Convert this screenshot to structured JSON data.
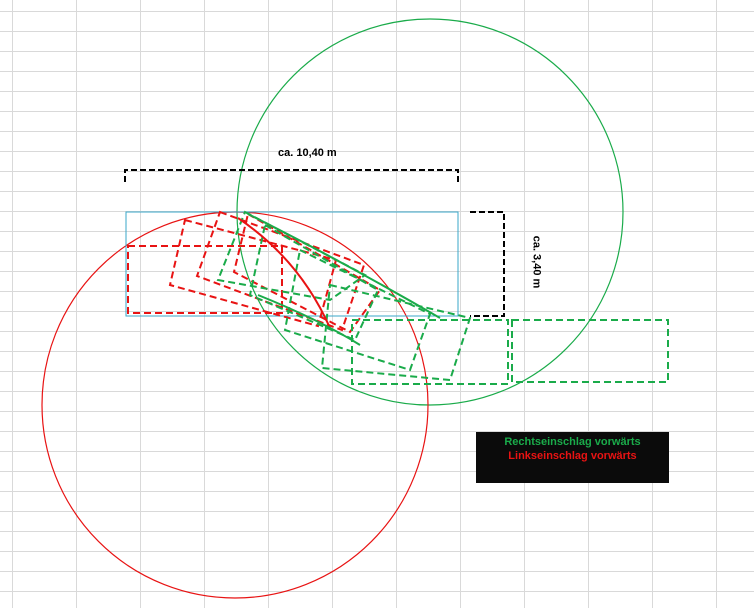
{
  "colors": {
    "right_steer": "#1aab4a",
    "left_steer": "#e81313",
    "outline": "#3aa7c9",
    "dimension": "#000000",
    "legend_bg": "#0b0b0b"
  },
  "dimensions": {
    "width_label": "ca. 10,40 m",
    "height_label": "ca. 3,40 m"
  },
  "legend": {
    "right_label": "Rechtseinschlag vorwärts",
    "left_label": "Linkseinschlag vorwärts"
  }
}
